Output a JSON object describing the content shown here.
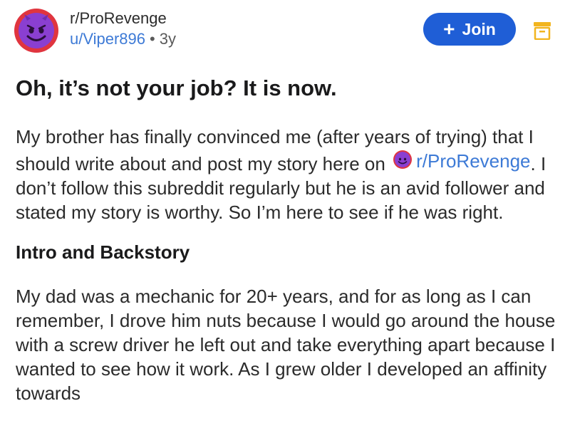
{
  "post": {
    "subreddit": "r/ProRevenge",
    "username": "u/Viper896",
    "separator": "•",
    "age": "3y",
    "join_label": "Join",
    "join_plus": "+",
    "title": "Oh, it’s not your job? It is now.",
    "para1_part1": "My brother has finally convinced me (after years of trying) that I should write about and post my story here on",
    "para1_link": "r/ProRevenge",
    "para1_part2": ".  I don’t follow this subreddit regularly but he is an avid follower and stated my story is worthy.  So I’m here to see if he was right.",
    "heading": "Intro and Backstory",
    "para2": "My dad was a mechanic for 20+ years, and for as long as I can remember, I drove him nuts because I would go around the house with a screw driver he left out and take everything apart because I wanted to see how it work.  As I grew older I developed an affinity towards"
  },
  "icons": {
    "avatar": "purple-devil-face-icon",
    "save": "bookmark-save-icon",
    "inline": "subreddit-devil-icon"
  },
  "colors": {
    "join_bg": "#1f5ed6",
    "link": "#3d7ad6",
    "avatar_ring": "#e0353f",
    "avatar_face": "#8a3fd1",
    "save_icon": "#f2b51f"
  }
}
